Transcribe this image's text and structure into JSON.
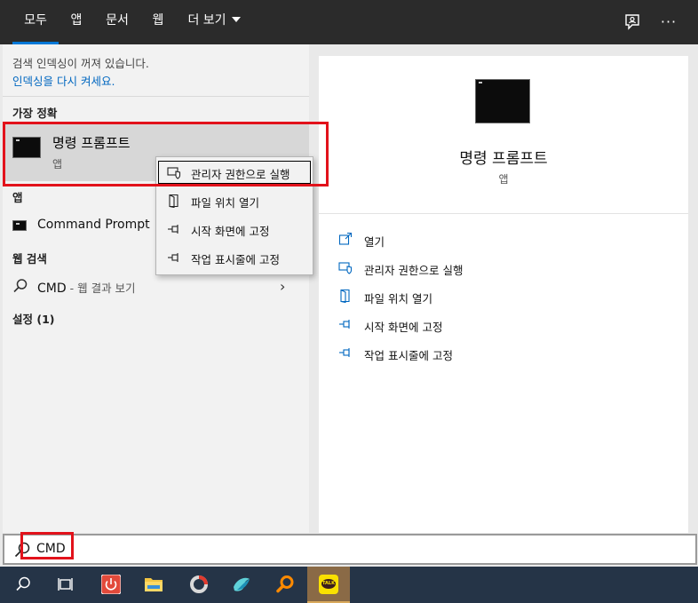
{
  "tabs": [
    {
      "label": "모두",
      "active": true
    },
    {
      "label": "앱"
    },
    {
      "label": "문서"
    },
    {
      "label": "웹"
    },
    {
      "label": "더 보기"
    }
  ],
  "top_icons": [
    "feedback-icon",
    "more-icon"
  ],
  "more_glyph": "···",
  "left": {
    "notice_line1": "검색 인덱싱이 꺼져 있습니다.",
    "notice_link": "인덱싱을 다시 켜세요.",
    "best_match_header": "가장 정확",
    "best_match": {
      "title": "명령 프롬프트",
      "subtitle": "앱",
      "icon": "command-prompt-icon"
    },
    "apps_header": "앱",
    "app_item": "Command Prompt",
    "web_header": "웹 검색",
    "web_item": {
      "query": "CMD",
      "suffix": " - 웹 결과 보기",
      "icon": "search-icon"
    },
    "settings_header": "설정 (1)"
  },
  "context_menu": [
    {
      "label": "관리자 권한으로 실행",
      "icon": "shield-icon",
      "focused": true
    },
    {
      "label": "파일 위치 열기",
      "icon": "folder-open-icon"
    },
    {
      "label": "시작 화면에 고정",
      "icon": "pin-icon"
    },
    {
      "label": "작업 표시줄에 고정",
      "icon": "pin-icon"
    }
  ],
  "preview": {
    "title": "명령 프롬프트",
    "subtitle": "앱",
    "actions": [
      {
        "label": "열기",
        "icon": "open-icon"
      },
      {
        "label": "관리자 권한으로 실행",
        "icon": "shield-icon"
      },
      {
        "label": "파일 위치 열기",
        "icon": "folder-open-icon"
      },
      {
        "label": "시작 화면에 고정",
        "icon": "pin-icon"
      },
      {
        "label": "작업 표시줄에 고정",
        "icon": "pin-icon"
      }
    ]
  },
  "search": {
    "value": "CMD"
  },
  "taskbar": [
    {
      "name": "search-icon"
    },
    {
      "name": "task-view-icon"
    },
    {
      "name": "power-app-icon"
    },
    {
      "name": "file-explorer-icon"
    },
    {
      "name": "app-ring-icon"
    },
    {
      "name": "bird-app-icon"
    },
    {
      "name": "magnifier-app-icon"
    },
    {
      "name": "kakaotalk-icon",
      "label": "TALK",
      "active": true
    }
  ],
  "colors": {
    "accent": "#0078d7",
    "link": "#0067c0",
    "annotation_red": "#e2121b",
    "taskbar": "#253447"
  }
}
